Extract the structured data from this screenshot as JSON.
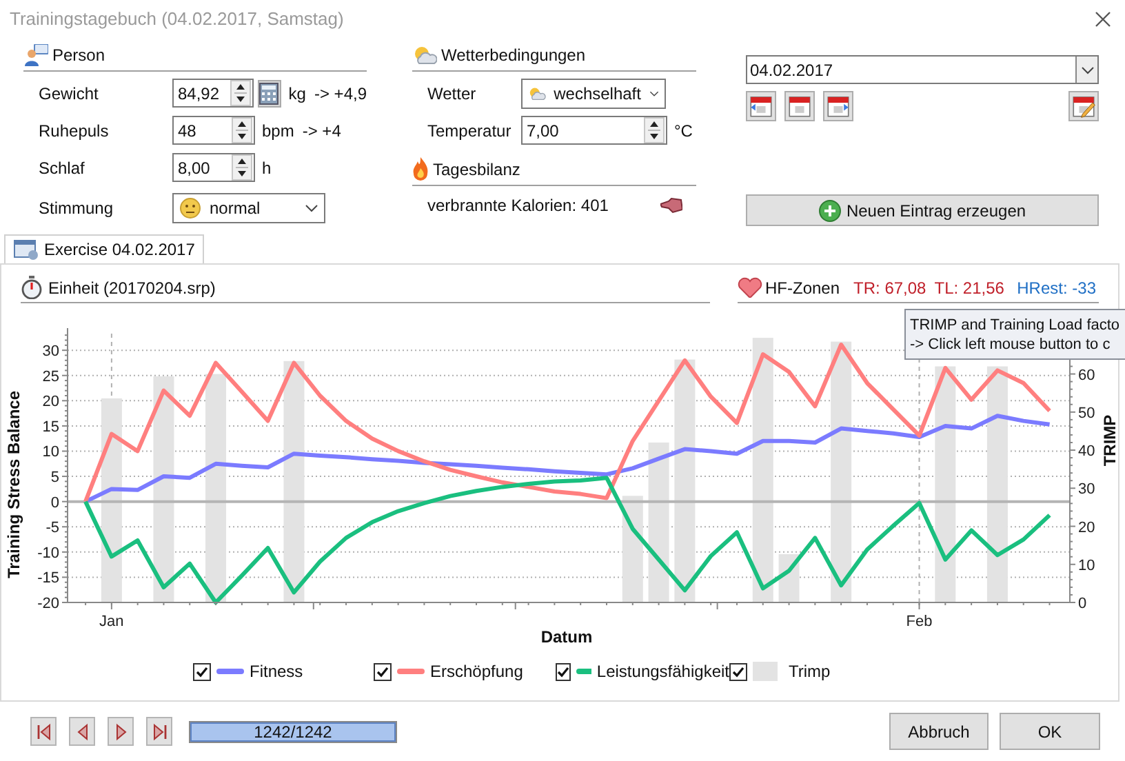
{
  "window": {
    "title": "Trainingstagebuch (04.02.2017, Samstag)"
  },
  "person": {
    "title": "Person",
    "fields": [
      {
        "kind": "spin",
        "label": "Gewicht",
        "value": "84,92",
        "unit": "kg",
        "change": "-> +4,9",
        "calculator": true
      },
      {
        "kind": "spin",
        "label": "Ruhepuls",
        "value": "48",
        "unit": "bpm",
        "change": "-> +4"
      },
      {
        "kind": "spin",
        "label": "Schlaf",
        "value": "8,00",
        "unit": "h"
      },
      {
        "kind": "dropdown",
        "label": "Stimmung",
        "value": "normal"
      }
    ]
  },
  "weather": {
    "title": "Wetterbedingungen",
    "fields": [
      {
        "kind": "dropdown",
        "label": "Wetter",
        "value": "wechselhaft"
      },
      {
        "kind": "spin",
        "label": "Temperatur",
        "value": "7,00",
        "unit": "°C"
      }
    ]
  },
  "balance": {
    "title": "Tagesbilanz",
    "text": "verbrannte Kalorien: 401"
  },
  "date": {
    "value": "04.02.2017"
  },
  "new_entry_button": "Neuen Eintrag erzeugen",
  "tabs": [
    {
      "label": "Exercise 04.02.2017",
      "selected": true
    }
  ],
  "exercise": {
    "unit": "Einheit (20170204.srp)",
    "hf_zones": "HF-Zonen",
    "tr": "TR: 67,08",
    "tl": "TL: 21,56",
    "hrest": "HRest: -33"
  },
  "chart_data": {
    "type": "line",
    "xlabel": "Datum",
    "ylabel": "Training Stress Balance",
    "y2label": "TRIMP",
    "categories": [
      null,
      "Jan",
      null,
      null,
      null,
      null,
      null,
      null,
      null,
      null,
      null,
      null,
      null,
      null,
      null,
      null,
      null,
      null,
      null,
      null,
      null,
      null,
      null,
      null,
      null,
      null,
      null,
      null,
      null,
      null,
      null,
      null,
      "Feb",
      null,
      null,
      null,
      null,
      null
    ],
    "grid": true,
    "ylim": [
      -20,
      33.3
    ],
    "y2lim": [
      0,
      70.6
    ],
    "yticks": [
      -20,
      -15,
      -10,
      -5,
      0,
      5,
      10,
      15,
      20,
      25,
      30
    ],
    "y2ticks": [
      0,
      10,
      20,
      30,
      40,
      50,
      60
    ],
    "series": [
      {
        "name": "Fitness",
        "color": "#7b7bff",
        "values": [
          0,
          2.5,
          2.3,
          5,
          4.7,
          7.5,
          7.1,
          6.8,
          9.5,
          9.1,
          8.8,
          8.4,
          8.1,
          7.7,
          7.4,
          7.1,
          6.7,
          6.4,
          6.0,
          5.7,
          5.4,
          6.6,
          8.5,
          10.4,
          10,
          9.5,
          12,
          12,
          11.7,
          14.5,
          14,
          13.5,
          12.8,
          15,
          14.5,
          17,
          16,
          15.3
        ]
      },
      {
        "name": "Erschöpfung",
        "color": "#ff7f7f",
        "values": [
          0,
          13.4,
          10,
          22,
          17,
          27.5,
          21.8,
          16,
          27.5,
          21,
          16,
          12.5,
          10,
          8,
          6.3,
          5,
          3.8,
          2.9,
          2.0,
          1.5,
          0.7,
          12,
          20,
          28,
          20.8,
          15.6,
          29.2,
          25.7,
          18.9,
          31.1,
          23.5,
          18.3,
          13.1,
          26.5,
          20.2,
          26,
          23.5,
          18
        ]
      },
      {
        "name": "Leistungsfähigkeit",
        "color": "#1abf7f",
        "values": [
          0,
          -10.9,
          -7.7,
          -17,
          -12.3,
          -20,
          -14.7,
          -9.2,
          -18,
          -11.9,
          -7.2,
          -4.1,
          -1.9,
          -0.3,
          1.1,
          2.1,
          2.9,
          3.5,
          4.0,
          4.2,
          4.7,
          -5.4,
          -11.5,
          -17.6,
          -10.8,
          -6.1,
          -17.2,
          -13.7,
          -7.2,
          -16.6,
          -9.5,
          -4.8,
          -0.3,
          -11.5,
          -5.7,
          -10.6,
          -7.5,
          -2.7
        ]
      },
      {
        "name": "Trimp",
        "type": "bar",
        "axis": "y2",
        "color": "#e3e3e3",
        "values": [
          null,
          53.6,
          null,
          59.4,
          null,
          60,
          null,
          null,
          63.4,
          null,
          null,
          null,
          null,
          null,
          null,
          null,
          null,
          null,
          null,
          null,
          null,
          28,
          42,
          63.8,
          null,
          null,
          69.5,
          12.7,
          null,
          68.5,
          null,
          null,
          null,
          62,
          null,
          62,
          null,
          null
        ]
      }
    ]
  },
  "tooltip": [
    "TRIMP and Training Load facto",
    "-> Click left mouse button to c"
  ],
  "legend": [
    {
      "checked": true
    },
    {
      "checked": true
    },
    {
      "checked": true
    },
    {
      "checked": true
    }
  ],
  "progress": {
    "text": "1242/1242",
    "level": 1
  },
  "buttons": [
    "Abbruch",
    "OK"
  ]
}
